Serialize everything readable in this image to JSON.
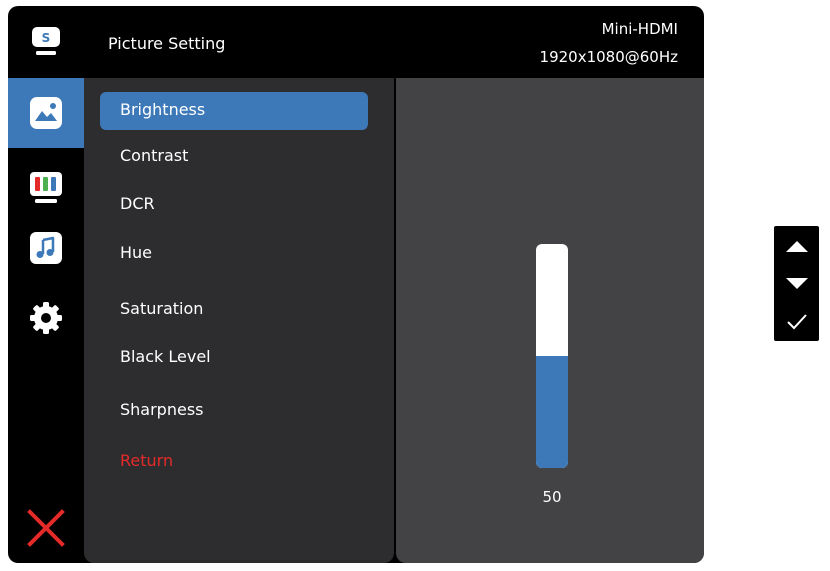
{
  "header": {
    "title": "Picture Setting",
    "input_source": "Mini-HDMI",
    "resolution": "1920x1080@60Hz"
  },
  "rail": {
    "items": [
      {
        "icon": "source-icon",
        "label": "S"
      },
      {
        "icon": "picture-icon",
        "active": true
      },
      {
        "icon": "color-icon"
      },
      {
        "icon": "audio-icon"
      },
      {
        "icon": "settings-icon"
      },
      {
        "icon": "close-icon"
      }
    ]
  },
  "menu": {
    "items": [
      {
        "label": "Brightness",
        "selected": true
      },
      {
        "label": "Contrast"
      },
      {
        "label": "DCR"
      },
      {
        "label": "Hue"
      },
      {
        "label": "Saturation"
      },
      {
        "label": "Black Level"
      },
      {
        "label": "Sharpness"
      },
      {
        "label": "Return",
        "color": "#e52a2a"
      }
    ]
  },
  "slider": {
    "value": "50",
    "level_percent": 50
  },
  "keypad": {
    "keys": [
      "up-icon",
      "down-icon",
      "confirm-icon"
    ]
  },
  "colors": {
    "accent": "#3d79b8",
    "return": "#e52a2a",
    "close": "#e52a2a"
  }
}
